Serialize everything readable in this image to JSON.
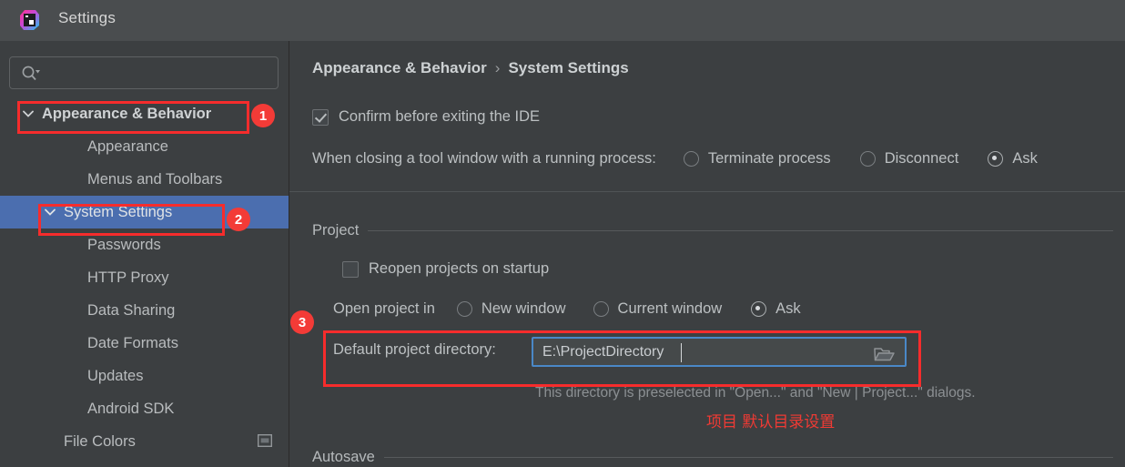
{
  "window": {
    "title": "Settings",
    "logo_icon": "intellij-idea-logo"
  },
  "search": {
    "value": "",
    "placeholder": "",
    "icon": "search-icon"
  },
  "sidebar": {
    "items": [
      {
        "label": "Appearance & Behavior",
        "level": 0,
        "expanded": true,
        "selected": false,
        "bold": true
      },
      {
        "label": "Appearance",
        "level": 1,
        "expanded": false,
        "selected": false,
        "bold": false
      },
      {
        "label": "Menus and Toolbars",
        "level": 1,
        "expanded": false,
        "selected": false,
        "bold": false
      },
      {
        "label": "System Settings",
        "level": 1,
        "expanded": true,
        "selected": true,
        "bold": false
      },
      {
        "label": "Passwords",
        "level": 2,
        "expanded": false,
        "selected": false,
        "bold": false
      },
      {
        "label": "HTTP Proxy",
        "level": 2,
        "expanded": false,
        "selected": false,
        "bold": false
      },
      {
        "label": "Data Sharing",
        "level": 2,
        "expanded": false,
        "selected": false,
        "bold": false
      },
      {
        "label": "Date Formats",
        "level": 2,
        "expanded": false,
        "selected": false,
        "bold": false
      },
      {
        "label": "Updates",
        "level": 2,
        "expanded": false,
        "selected": false,
        "bold": false
      },
      {
        "label": "Android SDK",
        "level": 2,
        "expanded": false,
        "selected": false,
        "bold": false
      },
      {
        "label": "File Colors",
        "level": 1,
        "expanded": false,
        "selected": false,
        "bold": false,
        "trailing_icon": "panel-window-icon"
      }
    ]
  },
  "breadcrumb": {
    "parent": "Appearance & Behavior",
    "separator": "›",
    "current": "System Settings"
  },
  "main": {
    "confirm_exit": {
      "label": "Confirm before exiting the IDE",
      "checked": true
    },
    "tool_window_close": {
      "label": "When closing a tool window with a running process:",
      "options": [
        "Terminate process",
        "Disconnect",
        "Ask"
      ],
      "selected": "Ask"
    },
    "project_group": {
      "title": "Project",
      "reopen": {
        "label": "Reopen projects on startup",
        "checked": false
      },
      "open_project_in": {
        "label": "Open project in",
        "options": [
          "New window",
          "Current window",
          "Ask"
        ],
        "selected": "Ask"
      },
      "default_dir": {
        "label": "Default project directory:",
        "value": "E:\\ProjectDirectory",
        "browse_icon": "folder-open-icon",
        "hint": "This directory is preselected in \"Open...\" and \"New | Project...\" dialogs."
      }
    },
    "autosave_group": {
      "title": "Autosave"
    }
  },
  "annotations": {
    "note_cjk": "项目 默认目录设置",
    "badges": [
      "1",
      "2",
      "3"
    ],
    "color": "#f62c2c"
  },
  "colors": {
    "background": "#3c3f41",
    "titlebar": "#4a4d4f",
    "selection": "#4b6eaf",
    "focus_border": "#4a88c7",
    "annotation_red": "#f62c2c",
    "text": "#bcc0c2"
  }
}
